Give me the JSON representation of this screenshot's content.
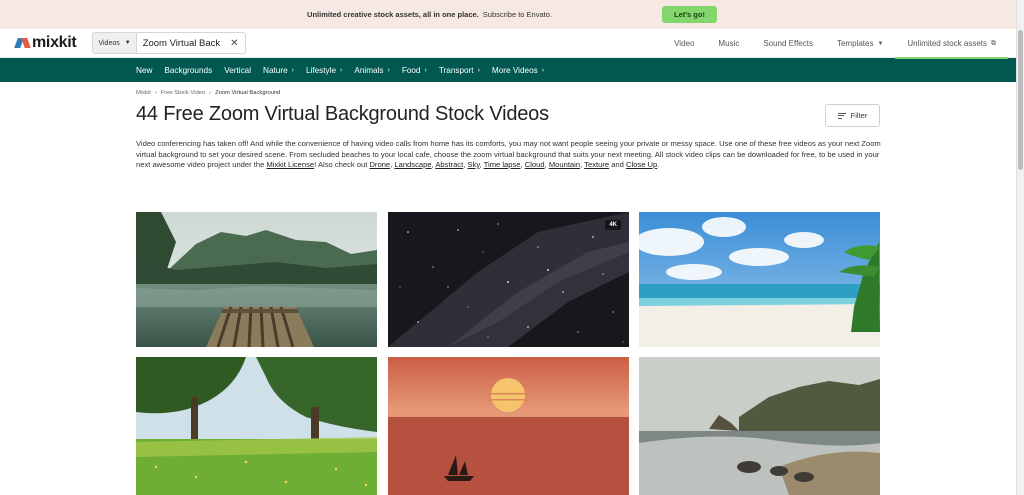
{
  "promo": {
    "headline": "Unlimited creative stock assets, all in one place.",
    "subtext": "Subscribe to Envato.",
    "cta": "Let's go!"
  },
  "header": {
    "logo": "mixkit",
    "search_type": "Videos",
    "search_query": "Zoom Virtual Back",
    "nav": [
      "Video",
      "Music",
      "Sound Effects",
      "Templates",
      "Unlimited stock assets"
    ]
  },
  "categories": [
    "New",
    "Backgrounds",
    "Vertical",
    "Nature",
    "Lifestyle",
    "Animals",
    "Food",
    "Transport",
    "More Videos"
  ],
  "breadcrumbs": [
    "Mixkit",
    "Free Stock Video",
    "Zoom Virtual Background"
  ],
  "title": "44 Free Zoom Virtual Background Stock Videos",
  "filter_label": "Filter",
  "description": {
    "text": "Video conferencing has taken off! And while the convenience of having video calls from home has its comforts, you may not want people seeing your private or messy space. Use one of these free videos as your next Zoom virtual background to set your desired scene. From secluded beaches to your local cafe, choose the zoom virtual background that suits your next meeting. All stock video clips can be downloaded for free, to be used in your next awesome video project under the",
    "license_link": "Mixkit License",
    "also": "! Also check out",
    "tags": [
      "Drone",
      "Landscape",
      "Abstract",
      "Sky",
      "Time lapse",
      "Cloud",
      "Mountain",
      "Texture"
    ],
    "and": "and",
    "last_tag": "Close Up",
    "end": "."
  },
  "videos": [
    {
      "scene": "lake-raft",
      "badge": ""
    },
    {
      "scene": "night-sky",
      "badge": "4K"
    },
    {
      "scene": "tropical-beach",
      "badge": ""
    },
    {
      "scene": "meadow-trees",
      "badge": ""
    },
    {
      "scene": "sunset-sailboat",
      "badge": ""
    },
    {
      "scene": "rocky-coast",
      "badge": ""
    }
  ]
}
